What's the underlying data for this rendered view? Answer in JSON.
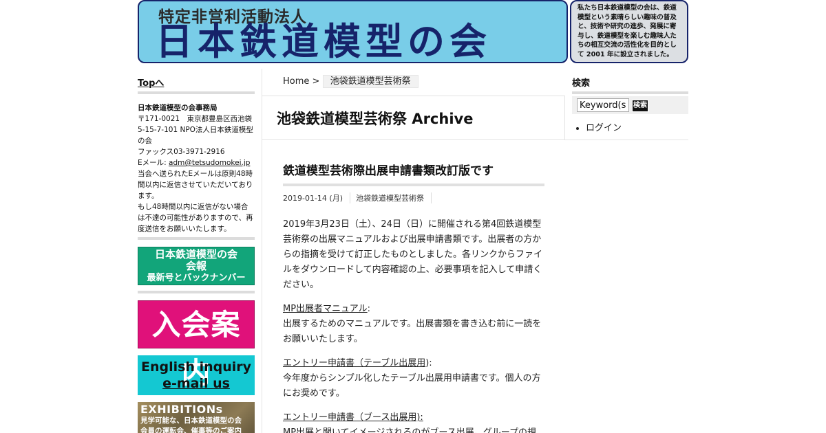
{
  "header": {
    "logo_sub": "特定非営利活動法人",
    "logo_main": "日本鉄道模型の会",
    "intro": "私たち日本鉄道模型の会は、鉄道模型という素晴らしい趣味の普及と、技術や研究の進歩、発展に寄与し、鉄道模型を楽しむ趣味人たちの相互交流の活性化を目的として 2001 年に設立されました。"
  },
  "left_sidebar": {
    "top_link": "Topへ",
    "office_title": "日本鉄道模型の会事務局",
    "address": "〒171-0021　東京都豊島区西池袋5-15-7-101 NPO法人日本鉄道模型の会",
    "fax": "ファックス03-3971-2916",
    "email_label": "Eメール: ",
    "email": "adm@tetsudomokei.jp",
    "note1": "当会へ送られたEメールは原則48時間以内に返信させていただいております。",
    "note2": "もし48時間以内に返信がない場合は不達の可能性がありますので、再度送信をお願いいたします。",
    "banner_newsletter": {
      "line1": "日本鉄道模型の会",
      "line2": "会報",
      "line3": "最新号とバックナンバー"
    },
    "banner_join": "入会案内",
    "banner_english": {
      "line1": "English inquiry",
      "line2": "e-mail us"
    },
    "banner_exhibitions": {
      "line1": "EXHIBITIONs",
      "line2": "見学可能な、日本鉄道模型の会",
      "line3": "会員の運転会、催事等のご案内"
    },
    "colors": {
      "newsletter": "#12a57a",
      "join": "#e0117a",
      "english": "#14c8d2"
    }
  },
  "breadcrumb": {
    "home": "Home",
    "separator": ">",
    "current": "池袋鉄道模型芸術祭"
  },
  "archive_title": "池袋鉄道模型芸術祭 Archive",
  "post": {
    "title": "鉄道模型芸術際出展申請書類改訂版です",
    "date": "2019-01-14 (月)",
    "category": "池袋鉄道模型芸術祭",
    "intro": "2019年3月23日（土）、24日（日）に開催される第4回鉄道模型芸術祭の出展マニュアルおよび出展申請書類です。出展者の方からの指摘を受けて訂正したものとしました。各リンクからファイルをダウンロードして内容確認の上、必要事項を記入して申請ください。",
    "items": [
      {
        "link": "MP出展者マニュアル",
        "suffix": ":",
        "desc": "出展するためのマニュアルです。出展書類を書き込む前に一読をお願いいたします。"
      },
      {
        "link": "エントリー申請書（テーブル出展用",
        "suffix": "):",
        "desc": "今年度からシンプル化したテーブル出展用申請書です。個人の方にお奨めです。"
      },
      {
        "link": "エントリー申請書（ブース出展用):",
        "suffix": "",
        "desc": "MP出展と聞いてイメージされるのがブース出展。グループの規"
      }
    ]
  },
  "right_sidebar": {
    "search_title": "検索",
    "search_placeholder": "Keyword(s)",
    "search_button": "検索",
    "login": "ログイン"
  }
}
